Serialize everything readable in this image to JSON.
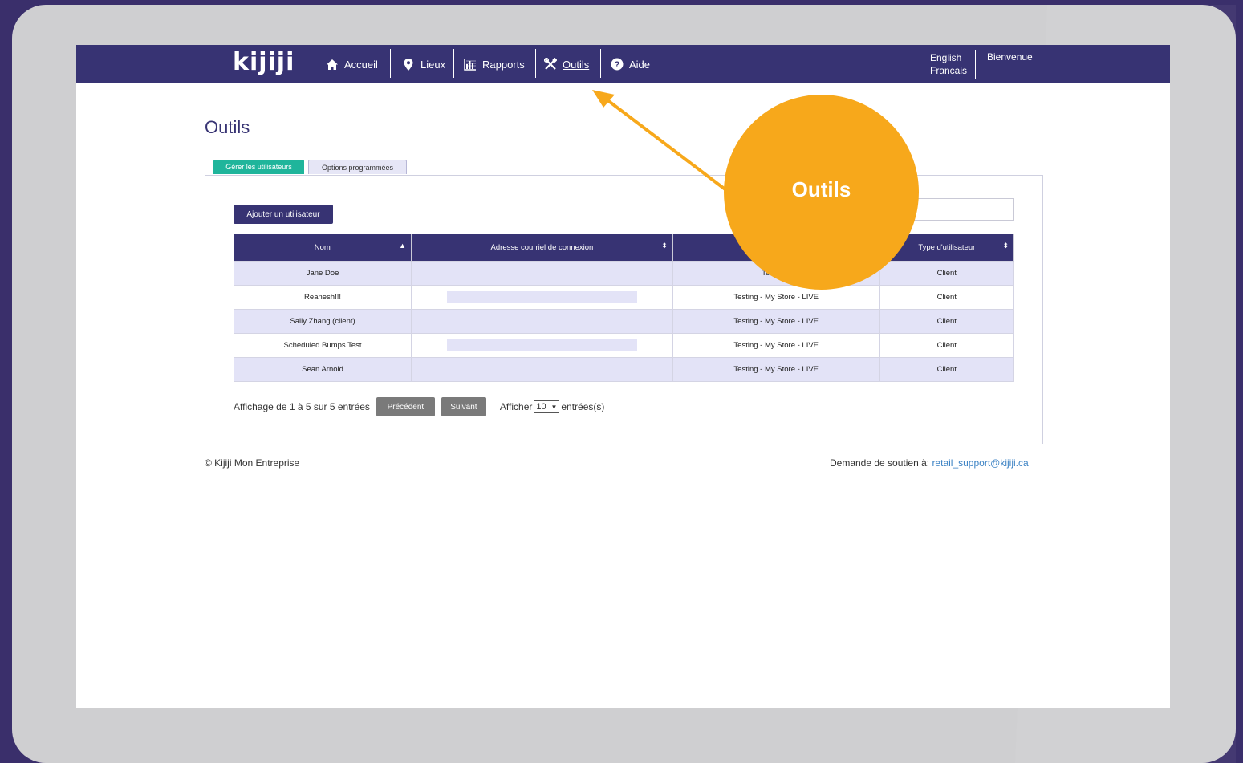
{
  "brand": {
    "logo_text": "kijiji"
  },
  "nav": {
    "items": [
      {
        "label": "Accueil",
        "icon": "home-icon"
      },
      {
        "label": "Lieux",
        "icon": "location-pin-icon"
      },
      {
        "label": "Rapports",
        "icon": "report-chart-icon"
      },
      {
        "label": "Outils",
        "icon": "tools-icon",
        "active": true
      },
      {
        "label": "Aide",
        "icon": "help-icon"
      }
    ],
    "language": {
      "english": "English",
      "french": "Francais"
    },
    "welcome": "Bienvenue"
  },
  "page": {
    "title": "Outils"
  },
  "tabs": [
    {
      "label": "Gérer les utilisateurs",
      "active": true
    },
    {
      "label": "Options programmées",
      "active": false
    }
  ],
  "toolbar": {
    "add_user_label": "Ajouter un utilisateur"
  },
  "table": {
    "columns": [
      "Nom",
      "Adresse courriel de connexion",
      "",
      "Type d'utilisateur"
    ],
    "rows": [
      {
        "name": "Jane Doe",
        "email": "",
        "store": "Testing - ",
        "type": "Client"
      },
      {
        "name": "Reanesh!!!",
        "email": "",
        "store": "Testing - My Store - LIVE",
        "type": "Client"
      },
      {
        "name": "Sally Zhang (client)",
        "email": "",
        "store": "Testing - My Store - LIVE",
        "type": "Client"
      },
      {
        "name": "Scheduled Bumps Test",
        "email": "",
        "store": "Testing - My Store - LIVE",
        "type": "Client"
      },
      {
        "name": "Sean Arnold",
        "email": "",
        "store": "Testing - My Store - LIVE",
        "type": "Client"
      }
    ]
  },
  "pagination": {
    "info": "Affichage de 1 à 5 sur 5 entrées",
    "prev_label": "Précédent",
    "next_label": "Suivant",
    "show_label": "Afficher",
    "page_size": "10",
    "entries_label": "entrées(s)"
  },
  "footer": {
    "copyright": "© Kijiji Mon Entreprise",
    "support_label": "Demande de soutien à:",
    "support_email": "retail_support@kijiji.ca"
  },
  "callout": {
    "label": "Outils"
  },
  "colors": {
    "nav": "#373373",
    "accent_tab": "#1fb59b",
    "callout": "#f7a81b",
    "frame": "#3a2f6b"
  }
}
